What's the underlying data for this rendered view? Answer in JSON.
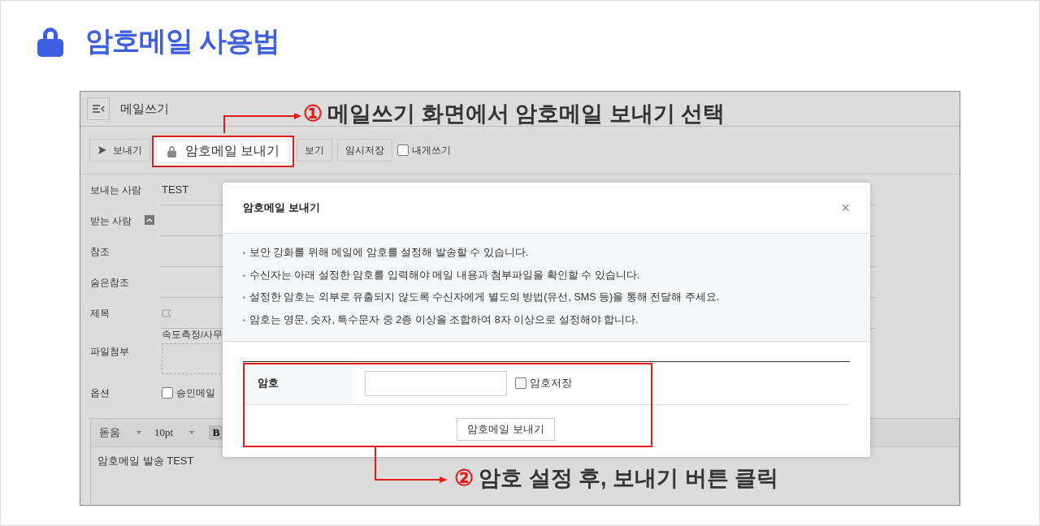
{
  "page_title": "암호메일 사용법",
  "app": {
    "title": "메일쓰기",
    "toolbar": [
      {
        "kind": "send",
        "label": "보내기"
      },
      {
        "kind": "highlight",
        "label": "암호메일 보내기"
      },
      {
        "kind": "plain",
        "label": "보기"
      },
      {
        "kind": "plain",
        "label": "임시저장"
      },
      {
        "kind": "checkbox",
        "label": "내게쓰기",
        "checked": false
      }
    ],
    "fields": [
      {
        "kind": "text",
        "label": "보내는 사람",
        "value": "TEST"
      },
      {
        "kind": "toggle",
        "label": "받는 사람"
      },
      {
        "kind": "blank",
        "label": "참조"
      },
      {
        "kind": "blank",
        "label": "숨은참조"
      },
      {
        "kind": "subject",
        "label": "제목"
      },
      {
        "kind": "attach",
        "label": "파일첨부",
        "value": "속도측정/사무"
      },
      {
        "kind": "option",
        "label": "옵션",
        "option": "승인메일",
        "checked": false
      }
    ],
    "editor": {
      "font": "돋움",
      "size": "10pt",
      "bold": "B",
      "body": "암호메일 발송 TEST"
    }
  },
  "dialog": {
    "title": "암호메일 보내기",
    "close": "×",
    "notes": [
      "보안 강화를 위해 메일에 암호를 설정해 발송할 수 있습니다.",
      "수신자는 아래 설정한 암호를 입력해야 메일 내용과 첨부파일을 확인할 수 있습니다.",
      "설정한 암호는 외부로 유출되지 않도록 수신자에게 별도의 방법(유선, SMS 등)을 통해 전달해 주세요.",
      "암호는 영문, 숫자, 특수문자 중 2종 이상을 조합하여 8자 이상으로 설정해야 합니다."
    ],
    "password_label": "암호",
    "save_password": {
      "label": "암호저장",
      "checked": false
    },
    "submit": "암호메일 보내기"
  },
  "callouts": [
    {
      "number": "①",
      "text": "메일쓰기 화면에서 암호메일 보내기 선택"
    },
    {
      "number": "②",
      "text": "암호 설정 후, 보내기 버튼 클릭"
    }
  ]
}
